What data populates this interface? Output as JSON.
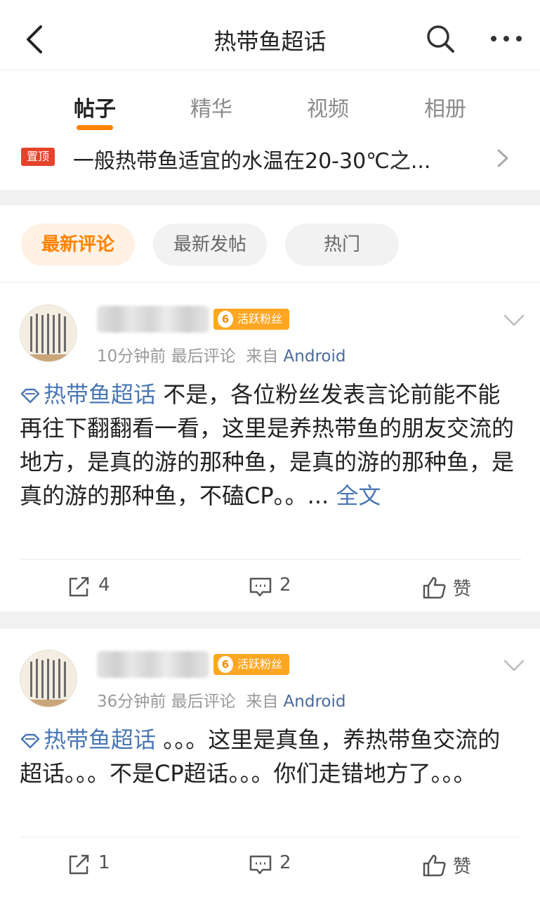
{
  "header": {
    "title": "热带鱼超话"
  },
  "tabs": [
    {
      "label": "帖子",
      "active": true
    },
    {
      "label": "精华",
      "active": false
    },
    {
      "label": "视频",
      "active": false
    },
    {
      "label": "相册",
      "active": false
    }
  ],
  "pinned": {
    "badge": "置顶",
    "text": "一般热带鱼适宜的水温在20-30℃之..."
  },
  "filters": [
    {
      "label": "最新评论",
      "active": true
    },
    {
      "label": "最新发帖",
      "active": false
    },
    {
      "label": "热门",
      "active": false
    }
  ],
  "colors": {
    "accent": "#ff8200",
    "link": "#4a77b4",
    "pin": "#e5432b"
  },
  "posts": [
    {
      "fan_level": "6",
      "fan_badge": "活跃粉丝",
      "time": "10分钟前",
      "last_comment": "最后评论",
      "from": "来自",
      "source": "Android",
      "topic": "热带鱼超话",
      "body": " 不是，各位粉丝发表言论前能不能再往下翻翻看一看，这里是养热带鱼的朋友交流的地方，是真的游的那种鱼，是真的游的那种鱼，是真的游的那种鱼，不磕CP。。...",
      "full_text_link": " 全文",
      "reposts": "4",
      "comments": "2",
      "like_label": "赞"
    },
    {
      "fan_level": "6",
      "fan_badge": "活跃粉丝",
      "time": "36分钟前",
      "last_comment": "最后评论",
      "from": "来自",
      "source": "Android",
      "topic": "热带鱼超话",
      "body": " 。。。这里是真鱼，养热带鱼交流的超话。。。不是CP超话。。。你们走错地方了。。。",
      "reposts": "1",
      "comments": "2",
      "like_label": "赞"
    }
  ]
}
